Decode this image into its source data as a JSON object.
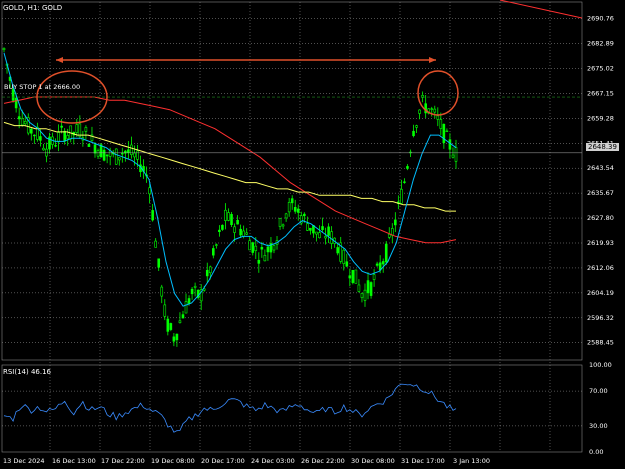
{
  "chart_title": "GOLD, H1:  GOLD",
  "order_label": "BUY STOP 1 at 2666.00",
  "order_price": 2666.0,
  "current_price": "2648.39",
  "current_price_value": 2648.39,
  "rsi_label": "RSI(14) 46.16",
  "colors": {
    "background": "#000000",
    "grid": "#c8c8c8",
    "bull_candle": "#00ff00",
    "bear_candle": "#00ff00",
    "ma_fast": "#00bfff",
    "ma_mid": "#ffff66",
    "ma_slow": "#ff3030",
    "ma_slowest": "#7fbf7f",
    "annotation": "#e0502a",
    "rsi_line": "#3a8cff"
  },
  "chart_data": {
    "type": "line",
    "price_axis_ticks": [
      "2690.76",
      "2682.89",
      "2675.02",
      "2667.15",
      "2659.28",
      "2651.41",
      "2643.54",
      "2635.67",
      "2627.80",
      "2619.93",
      "2612.06",
      "2604.19",
      "2596.32",
      "2588.45"
    ],
    "price_range": [
      2583,
      2696
    ],
    "rsi_axis_ticks": [
      "100.00",
      "70.00",
      "30.00",
      "0.00"
    ],
    "rsi_levels": [
      70,
      30
    ],
    "time_axis_ticks": [
      "13 Dec 2024",
      "16 Dec 13:00",
      "17 Dec 22:00",
      "19 Dec 08:00",
      "20 Dec 17:00",
      "24 Dec 03:00",
      "26 Dec 22:00",
      "30 Dec 08:00",
      "31 Dec 17:00",
      "3 Jan 13:00"
    ],
    "price_path": [
      2681,
      2668,
      2660,
      2656,
      2654,
      2650,
      2652,
      2655,
      2654,
      2656,
      2653,
      2650,
      2648,
      2647,
      2649,
      2648,
      2645,
      2640,
      2615,
      2595,
      2590,
      2598,
      2604,
      2603,
      2610,
      2620,
      2628,
      2626,
      2624,
      2620,
      2616,
      2618,
      2622,
      2630,
      2632,
      2628,
      2625,
      2622,
      2623,
      2620,
      2614,
      2610,
      2604,
      2606,
      2612,
      2618,
      2628,
      2640,
      2656,
      2664,
      2662,
      2658,
      2652,
      2648
    ],
    "ma_fast_path": [
      2680,
      2670,
      2662,
      2658,
      2656,
      2653,
      2652,
      2652,
      2653,
      2653,
      2652,
      2651,
      2650,
      2648,
      2647,
      2646,
      2644,
      2640,
      2628,
      2614,
      2604,
      2600,
      2601,
      2604,
      2608,
      2613,
      2618,
      2621,
      2622,
      2622,
      2620,
      2619,
      2620,
      2622,
      2625,
      2627,
      2626,
      2624,
      2622,
      2620,
      2618,
      2614,
      2611,
      2610,
      2611,
      2614,
      2620,
      2630,
      2640,
      2648,
      2654,
      2654,
      2652,
      2650
    ],
    "ma_mid_path": [
      2658,
      2657,
      2657,
      2656,
      2656,
      2655,
      2655,
      2654,
      2654,
      2653,
      2652,
      2651,
      2650,
      2649,
      2648,
      2647,
      2646,
      2645,
      2644,
      2643,
      2642,
      2641,
      2640,
      2639,
      2639,
      2638,
      2637,
      2637,
      2636,
      2636,
      2635,
      2635,
      2635,
      2635,
      2634,
      2634,
      2633,
      2633,
      2632,
      2632,
      2631,
      2631,
      2630,
      2630
    ],
    "ma_slow_path": [
      2664,
      2665,
      2666,
      2666,
      2666,
      2666,
      2666,
      2665,
      2665,
      2664,
      2663,
      2662,
      2660,
      2658,
      2656,
      2653,
      2650,
      2647,
      2643,
      2639,
      2636,
      2633,
      2630,
      2628,
      2626,
      2624,
      2622,
      2621,
      2620,
      2620,
      2621
    ],
    "rsi_path": [
      42,
      38,
      55,
      48,
      52,
      46,
      50,
      60,
      45,
      58,
      48,
      52,
      44,
      40,
      46,
      50,
      54,
      48,
      42,
      30,
      20,
      35,
      42,
      50,
      48,
      55,
      60,
      58,
      52,
      48,
      54,
      50,
      46,
      52,
      55,
      48,
      44,
      50,
      46,
      52,
      48,
      42,
      50,
      56,
      60,
      72,
      80,
      78,
      74,
      68,
      60,
      52,
      46
    ]
  }
}
